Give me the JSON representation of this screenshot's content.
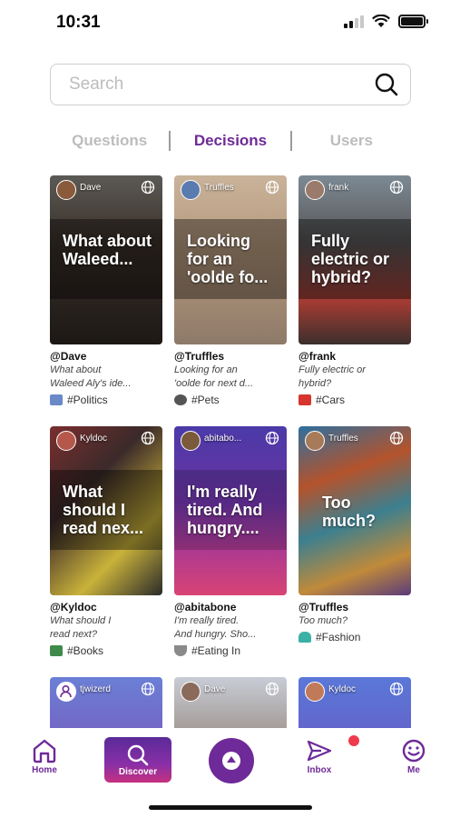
{
  "status": {
    "time": "10:31"
  },
  "search": {
    "placeholder": "Search",
    "value": ""
  },
  "tabs": [
    {
      "label": "Questions",
      "active": false
    },
    {
      "label": "Decisions",
      "active": true
    },
    {
      "label": "Users",
      "active": false
    }
  ],
  "cards": [
    {
      "user_tag": "Dave",
      "overlay": "What about\nWaleed...",
      "handle": "@Dave",
      "snippet": "What about\nWaleed Aly's ide...",
      "tag": "#Politics",
      "tag_icon": "globe-sticker-icon",
      "tag_color": "#6a89c7",
      "bg": "linear-gradient(180deg,#5c5a55 0%,#3a3029 40%,#1c1815 100%)"
    },
    {
      "user_tag": "Truffles",
      "overlay": "Looking\nfor an\n'oolde fo...",
      "handle": "@Truffles",
      "snippet": "Looking for an\n'oolde for next d...",
      "tag": "#Pets",
      "tag_icon": "paw-icon",
      "tag_color": "#555555",
      "bg": "linear-gradient(180deg,#c9b39a 0%,#b5987c 45%,#8e7a69 100%)"
    },
    {
      "user_tag": "frank",
      "overlay": "Fully\nelectric or\nhybrid?",
      "handle": "@frank",
      "snippet": "Fully electric or\nhybrid?",
      "tag": "#Cars",
      "tag_icon": "car-icon",
      "tag_color": "#d6342c",
      "bg": "linear-gradient(180deg,#7c8a94 0%,#565455 40%,#a33b33 75%,#3b2f2c 100%)"
    },
    {
      "user_tag": "Kyldoc",
      "overlay": "What\nshould I\nread nex...",
      "handle": "@Kyldoc",
      "snippet": "What should I\nread next?",
      "tag": "#Books",
      "tag_icon": "books-icon",
      "tag_color": "#3f8a4a",
      "bg": "linear-gradient(135deg,#7a2e2e 0%,#3b2a2a 35%,#c9b23a 70%,#2a2a2a 100%)"
    },
    {
      "user_tag": "abitabo...",
      "overlay": "I'm really\ntired. And\nhungry....",
      "handle": "@abitabone",
      "snippet": "I'm really tired.\nAnd hungry. Sho...",
      "tag": "#Eating In",
      "tag_icon": "bowl-icon",
      "tag_color": "#8a8a8a",
      "bg": "linear-gradient(180deg,#4b3aa8 0%,#6a33a2 45%,#b03a8f 75%,#d84475 100%)"
    },
    {
      "user_tag": "Truffles",
      "overlay": "Too\nmuch?",
      "handle": "@Truffles",
      "snippet": "Too much?",
      "tag": "#Fashion",
      "tag_icon": "dress-icon",
      "tag_color": "#3bb0a6",
      "bg": "linear-gradient(160deg,#2e6f9e 0%,#b4532c 30%,#3c7f8f 55%,#c08a3a 80%,#5a3b7a 100%)"
    }
  ],
  "peek_cards": [
    {
      "user_tag": "tjwizerd"
    },
    {
      "user_tag": "Dave"
    },
    {
      "user_tag": "Kyldoc"
    }
  ],
  "nav": {
    "home": "Home",
    "discover": "Discover",
    "inbox": "Inbox",
    "me": "Me"
  },
  "colors": {
    "accent": "#6e2a98",
    "tab_inactive": "#bdbdbd",
    "notification": "#ef3a4e"
  }
}
